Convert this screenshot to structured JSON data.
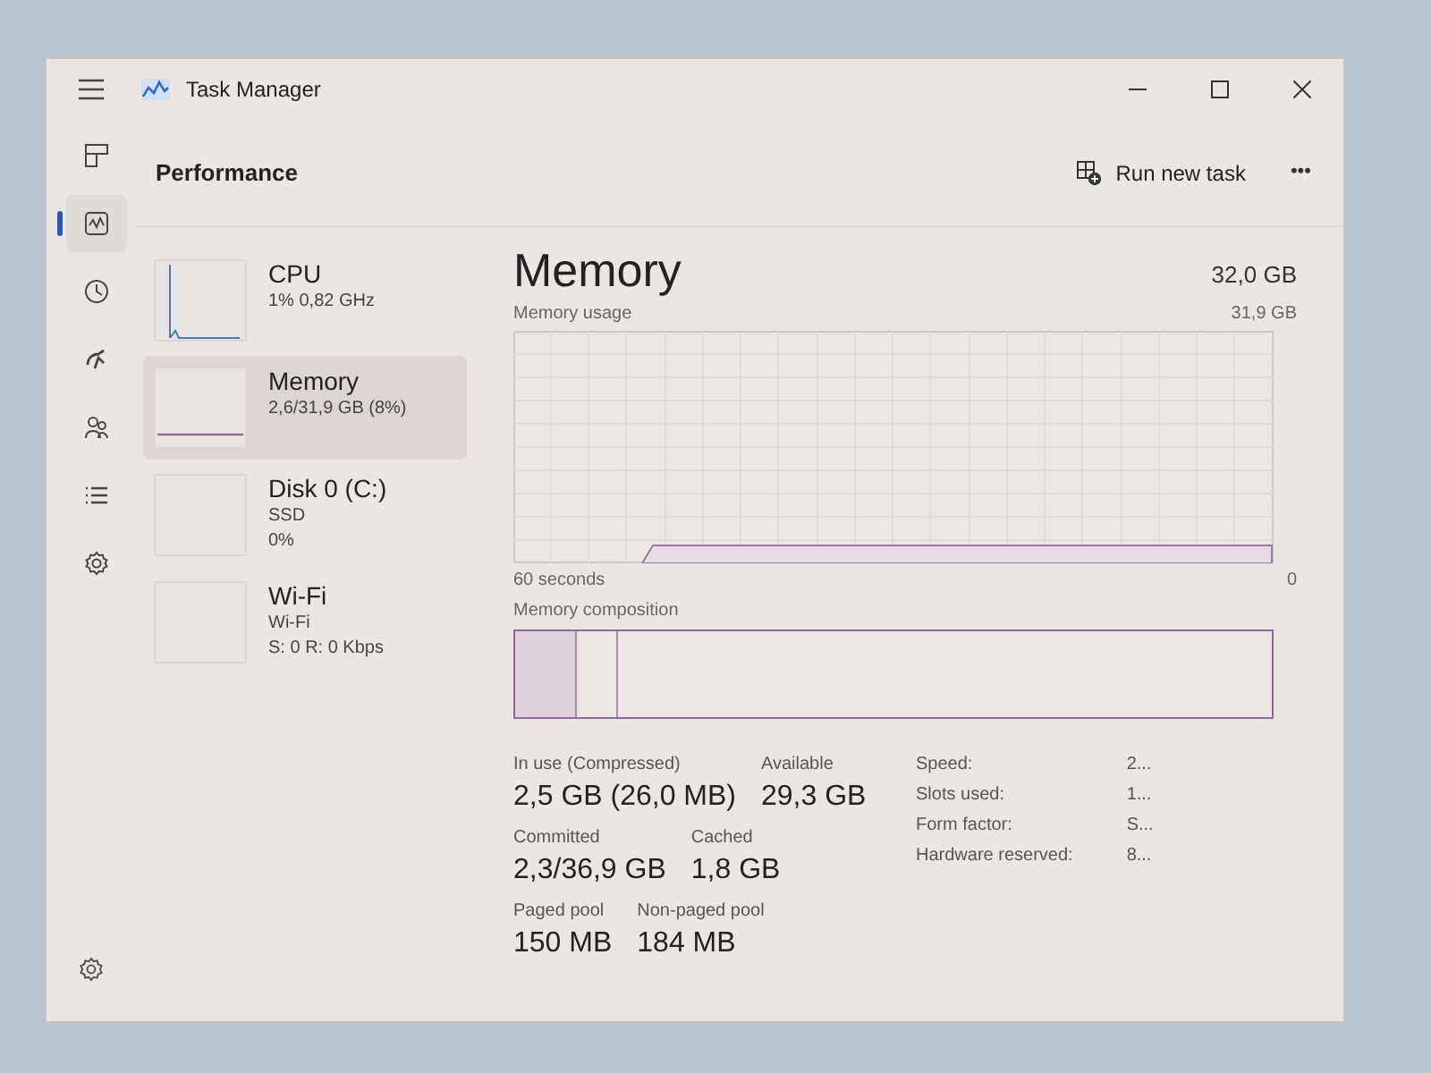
{
  "window": {
    "title": "Task Manager"
  },
  "nav": [
    {
      "kind": "processes",
      "selected": false
    },
    {
      "kind": "performance",
      "selected": true
    },
    {
      "kind": "history",
      "selected": false
    },
    {
      "kind": "startup",
      "selected": false
    },
    {
      "kind": "users",
      "selected": false
    },
    {
      "kind": "details",
      "selected": false
    },
    {
      "kind": "services",
      "selected": false
    }
  ],
  "page_title": "Performance",
  "toolbar": {
    "run_task": "Run new task",
    "more": "•••"
  },
  "devices": [
    {
      "kind": "cpu",
      "name": "CPU",
      "lines": [
        "1% 0,82 GHz"
      ],
      "selected": false
    },
    {
      "kind": "memory",
      "name": "Memory",
      "lines": [
        "2,6/31,9 GB (8%)"
      ],
      "selected": true
    },
    {
      "kind": "disk",
      "name": "Disk 0 (C:)",
      "lines": [
        "SSD",
        "0%"
      ],
      "selected": false
    },
    {
      "kind": "wifi",
      "name": "Wi-Fi",
      "lines": [
        "Wi-Fi",
        "S: 0 R: 0 Kbps"
      ],
      "selected": false
    }
  ],
  "detail": {
    "title": "Memory",
    "total": "32,0 GB",
    "graph_label": "Memory usage",
    "graph_max": "31,9 GB",
    "graph_time": "60 seconds",
    "graph_min": "0",
    "composition_label": "Memory composition",
    "stats": [
      [
        {
          "label": "In use (Compressed)",
          "value": "2,5 GB (26,0 MB)"
        },
        {
          "label": "Available",
          "value": "29,3 GB"
        }
      ],
      [
        {
          "label": "Committed",
          "value": "2,3/36,9 GB"
        },
        {
          "label": "Cached",
          "value": "1,8 GB"
        }
      ],
      [
        {
          "label": "Paged pool",
          "value": "150 MB"
        },
        {
          "label": "Non-paged pool",
          "value": "184 MB"
        }
      ]
    ],
    "properties": [
      {
        "label": "Speed:",
        "value": "2..."
      },
      {
        "label": "Slots used:",
        "value": "1..."
      },
      {
        "label": "Form factor:",
        "value": "S..."
      },
      {
        "label": "Hardware reserved:",
        "value": "8..."
      }
    ]
  }
}
